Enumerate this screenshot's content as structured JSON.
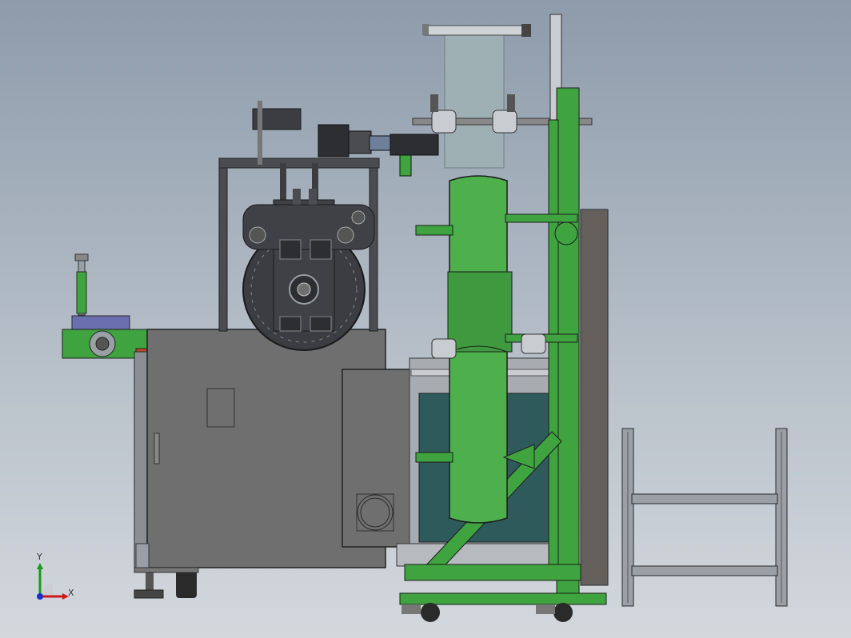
{
  "viewport": {
    "background_top": "#8d9bab",
    "background_bottom": "#d3d8dd"
  },
  "triad": {
    "x_label": "X",
    "y_label": "Y",
    "x_color": "#d01818",
    "y_color": "#1a9a1a",
    "z_color": "#1830c8"
  },
  "colors": {
    "green": "#3fa33f",
    "green_dark": "#2e7d2e",
    "gray_panel": "#6f6f6f",
    "gray_dark": "#3f4147",
    "steel": "#9a9fa6",
    "teal_glass": "#2f5a5c",
    "film": "#9fb0b4",
    "brown": "#7a5a3a"
  }
}
